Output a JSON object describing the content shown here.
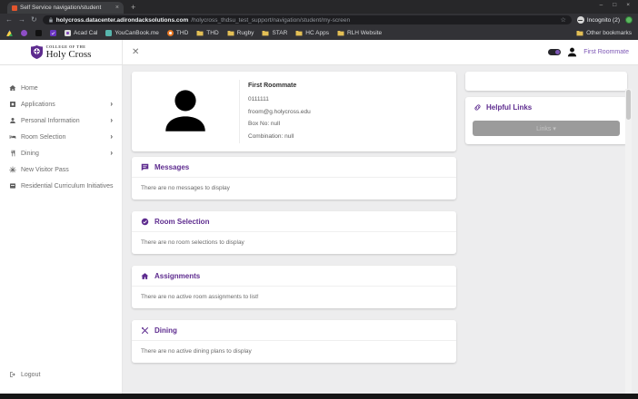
{
  "browser": {
    "tab": {
      "title": "Self Service navigation/student",
      "close_glyph": "×",
      "new_tab_glyph": "+"
    },
    "window_controls": {
      "minimize": "–",
      "maximize": "□",
      "close": "×"
    },
    "nav": {
      "back": "←",
      "forward": "→",
      "reload": "↻"
    },
    "address": {
      "domain": "holycross.datacenter.adirondacksolutions.com",
      "path": "/holycross_thdsu_test_support/navigation/student/my-screen",
      "star_glyph": "☆"
    },
    "profile_chip": {
      "label": "Incognito (2)"
    },
    "bookmarks_bar": {
      "icon_only": [
        {
          "icon": "drive-icon"
        },
        {
          "icon": "purple-dot-icon"
        },
        {
          "icon": "black-site-icon"
        },
        {
          "icon": "purple-check-icon"
        }
      ],
      "items": [
        {
          "icon": "calendar-icon",
          "label": "Acad Cal"
        },
        {
          "icon": "teal-site-icon",
          "label": "YouCanBook.me"
        },
        {
          "icon": "orange-site-icon",
          "label": "THD"
        },
        {
          "icon": "folder-icon",
          "label": "THD"
        },
        {
          "icon": "folder-icon",
          "label": "Rugby"
        },
        {
          "icon": "folder-icon",
          "label": "STAR"
        },
        {
          "icon": "folder-icon",
          "label": "HC Apps"
        },
        {
          "icon": "folder-icon",
          "label": "RLH Website"
        }
      ],
      "other_bookmarks": "Other bookmarks"
    }
  },
  "header": {
    "logo_line1": "COLLEGE OF THE",
    "logo_line2": "Holy Cross",
    "close_glyph": "✕",
    "user_name": "First Roommate"
  },
  "sidebar": {
    "chevron_glyph": "›",
    "items": [
      {
        "icon": "home-icon",
        "label": "Home",
        "expandable": false
      },
      {
        "icon": "applications-icon",
        "label": "Applications",
        "expandable": true
      },
      {
        "icon": "person-icon",
        "label": "Personal Information",
        "expandable": true
      },
      {
        "icon": "bed-icon",
        "label": "Room Selection",
        "expandable": true
      },
      {
        "icon": "dining-icon",
        "label": "Dining",
        "expandable": true
      },
      {
        "icon": "visitor-pass-icon",
        "label": "New Visitor Pass",
        "expandable": false
      },
      {
        "icon": "residential-icon",
        "label": "Residential Curriculum Initiatives",
        "expandable": false
      }
    ],
    "logout": {
      "icon": "logout-icon",
      "label": "Logout"
    }
  },
  "profile_card": {
    "name": "First Roommate",
    "student_id": "0111111",
    "email": "froom@g.holycross.edu",
    "box_line": "Box No: null",
    "combination_line": "Combination: null"
  },
  "sections": [
    {
      "icon": "message-icon",
      "title": "Messages",
      "body": "There are no messages to display"
    },
    {
      "icon": "check-circle-icon",
      "title": "Room Selection",
      "body": "There are no room selections to display"
    },
    {
      "icon": "house-icon",
      "title": "Assignments",
      "body": "There are no active room assignments to list!"
    },
    {
      "icon": "utensils-icon",
      "title": "Dining",
      "body": "There are no active dining plans to display"
    }
  ],
  "helpful_links": {
    "icon": "link-icon",
    "title": "Helpful Links",
    "button_label": "Links ▾"
  },
  "colors": {
    "brand_purple": "#5e2c8f",
    "accent_purple": "#7d57b5",
    "folder_yellow": "#e3bf55",
    "button_gray": "#9b9b9b",
    "chrome_dark": "#323236",
    "page_bg": "#ededee"
  }
}
